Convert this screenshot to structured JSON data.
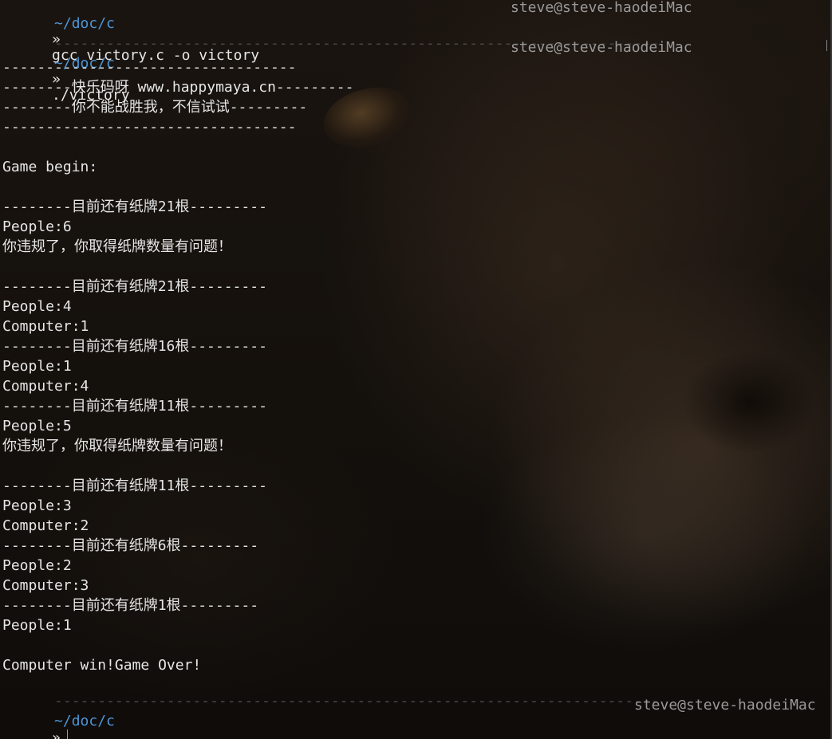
{
  "terminal": {
    "prompt_dir": "~/doc/c",
    "prompt_chev": "»",
    "host": "steve@steve-haodeiMac",
    "separator": "----------------------------------------------------------------------",
    "commands": {
      "compile": "gcc victory.c -o victory",
      "run": "./victory"
    },
    "output": [
      "----------------------------------",
      "--------快乐码呀 www.happymaya.cn---------",
      "--------你不能战胜我，不信试试---------",
      "----------------------------------",
      "",
      "Game begin:",
      "",
      "--------目前还有纸牌21根---------",
      "People:6",
      "你违规了，你取得纸牌数量有问题！",
      "",
      "--------目前还有纸牌21根---------",
      "People:4",
      "Computer:1",
      "--------目前还有纸牌16根---------",
      "People:1",
      "Computer:4",
      "--------目前还有纸牌11根---------",
      "People:5",
      "你违规了，你取得纸牌数量有问题！",
      "",
      "--------目前还有纸牌11根---------",
      "People:3",
      "Computer:2",
      "--------目前还有纸牌6根---------",
      "People:2",
      "Computer:3",
      "--------目前还有纸牌1根---------",
      "People:1",
      "",
      "Computer win!Game Over!"
    ]
  }
}
